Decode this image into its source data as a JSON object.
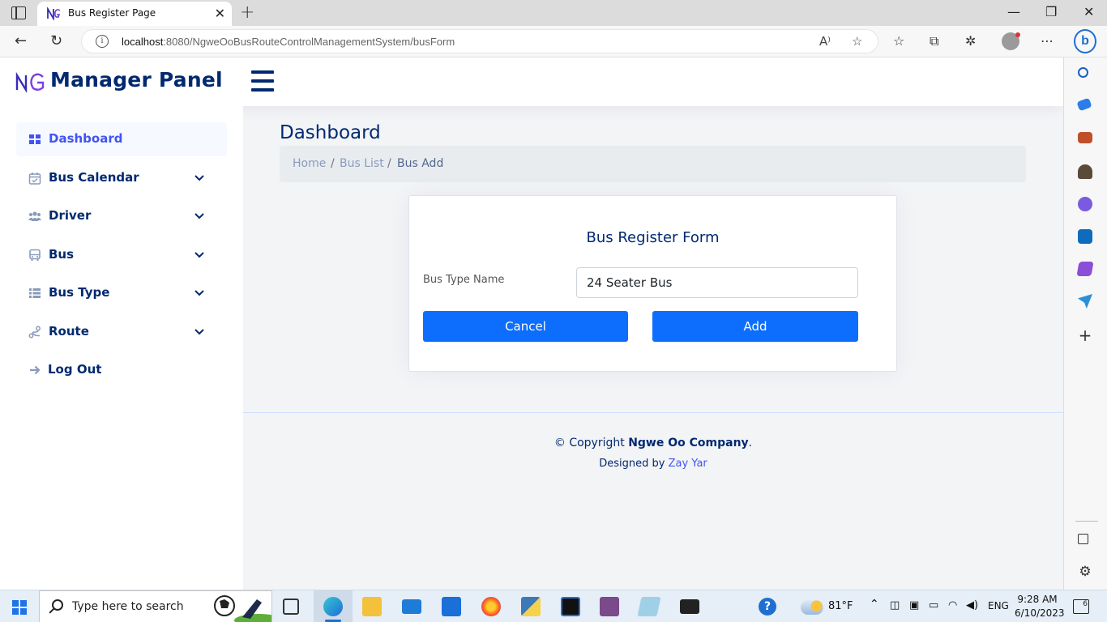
{
  "browser": {
    "tab_title": "Bus Register Page",
    "url_host": "localhost",
    "url_path": ":8080/NgweOoBusRouteControlManagementSystem/busForm",
    "new_tab_icon": "plus-icon",
    "read_aloud_label": "A⁾"
  },
  "header": {
    "logo_text": "Manager Panel",
    "logo_mark": "NG"
  },
  "sidebar": {
    "items": [
      {
        "label": "Dashboard",
        "icon": "grid-icon",
        "active": true
      },
      {
        "label": "Bus Calendar",
        "icon": "calendar-icon"
      },
      {
        "label": "Driver",
        "icon": "people-icon"
      },
      {
        "label": "Bus",
        "icon": "bus-icon"
      },
      {
        "label": "Bus Type",
        "icon": "list-icon"
      },
      {
        "label": "Route",
        "icon": "route-icon"
      },
      {
        "label": "Log Out",
        "icon": "arrow-right-icon"
      }
    ]
  },
  "main": {
    "page_title": "Dashboard",
    "breadcrumb": [
      "Home",
      "Bus List",
      "Bus Add"
    ],
    "breadcrumb_sep": "/",
    "form": {
      "title": "Bus Register Form",
      "label": "Bus Type Name",
      "value": "24 Seater Bus",
      "cancel_label": "Cancel",
      "add_label": "Add"
    },
    "footer": {
      "copyright_prefix": "© Copyright ",
      "company": "Ngwe Oo Company",
      "copyright_suffix": ".",
      "designed_by": "Designed by ",
      "designer": "Zay Yar"
    }
  },
  "taskbar": {
    "search_placeholder": "Type here to search",
    "weather": "81°F",
    "language": "ENG",
    "time": "9:28 AM",
    "date": "6/10/2023",
    "notification_count": "6"
  },
  "colors": {
    "brand": "#012970",
    "accent": "#4154f1",
    "button": "#0d6efd"
  }
}
